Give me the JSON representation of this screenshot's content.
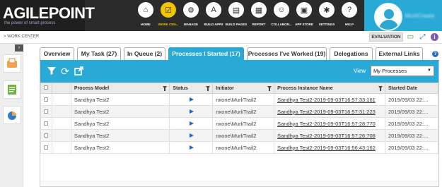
{
  "app": {
    "logo_text": "AGILEPOINT",
    "tagline": "the power of smart process"
  },
  "nav": [
    {
      "label": "HOME",
      "icon": "home-icon",
      "glyph": "⌂"
    },
    {
      "label": "WORK CEN...",
      "icon": "workcenter-icon",
      "glyph": "☑",
      "active": true
    },
    {
      "label": "MANAGE",
      "icon": "manage-icon",
      "glyph": "⚙"
    },
    {
      "label": "BUILD APPS",
      "icon": "build-apps-icon",
      "glyph": "A"
    },
    {
      "label": "BUILD PAGES",
      "icon": "build-pages-icon",
      "glyph": "▤"
    },
    {
      "label": "REPORT",
      "icon": "report-icon",
      "glyph": "▦"
    },
    {
      "label": "COLLABOR...",
      "icon": "collaborate-icon",
      "glyph": "☺"
    },
    {
      "label": "APP STORE",
      "icon": "app-store-icon",
      "glyph": "▣"
    },
    {
      "label": "SETTINGS",
      "icon": "settings-icon",
      "glyph": "✱"
    },
    {
      "label": "HELP",
      "icon": "help-icon",
      "glyph": "?"
    }
  ],
  "user": {
    "name": "MurliCreate"
  },
  "breadcrumb": "> WORK CENTER",
  "evaluation": "EVALUATION",
  "tabs": [
    {
      "label": "Overview"
    },
    {
      "label": "My Task (27)"
    },
    {
      "label": "In Queue (2)"
    },
    {
      "label": "Processes I Started (17)",
      "active": true
    },
    {
      "label": "Processes I've Worked (19)"
    },
    {
      "label": "Delegations"
    },
    {
      "label": "External Links"
    }
  ],
  "toolbar": {
    "view_label": "View",
    "view_value": "My Processes"
  },
  "table": {
    "columns": [
      "",
      "Process Model",
      "Status",
      "Initiator",
      "Process Instance Name",
      "Started Date"
    ],
    "rows": [
      {
        "model": "Sandhya Test2",
        "initiator": "nxone\\MurliTrail2",
        "instance": "Sandhya Test2-2019-09-03T16:57:33:161",
        "started": "2019/09/03 22:..."
      },
      {
        "model": "Sandhya Test2",
        "initiator": "nxone\\MurliTrail2",
        "instance": "Sandhya Test2-2019-09-03T16:57:31:223",
        "started": "2019/09/03 22:..."
      },
      {
        "model": "Sandhya Test2",
        "initiator": "nxone\\MurliTrail2",
        "instance": "Sandhya Test2-2019-09-03T16:57:28:770",
        "started": "2019/09/03 22:..."
      },
      {
        "model": "Sandhya Test2",
        "initiator": "nxone\\MurliTrail2",
        "instance": "Sandhya Test2-2019-09-03T16:57:26:708",
        "started": "2019/09/03 22:..."
      },
      {
        "model": "Sandhya Test2",
        "initiator": "nxone\\MurliTrail2",
        "instance": "Sandhya Test2-2019-09-03T16:56:43:162",
        "started": "2019/09/03 22:..."
      }
    ]
  },
  "colors": {
    "accent": "#29a9d6",
    "header_bg": "#2b2b2b",
    "active_nav": "#f2c500"
  }
}
